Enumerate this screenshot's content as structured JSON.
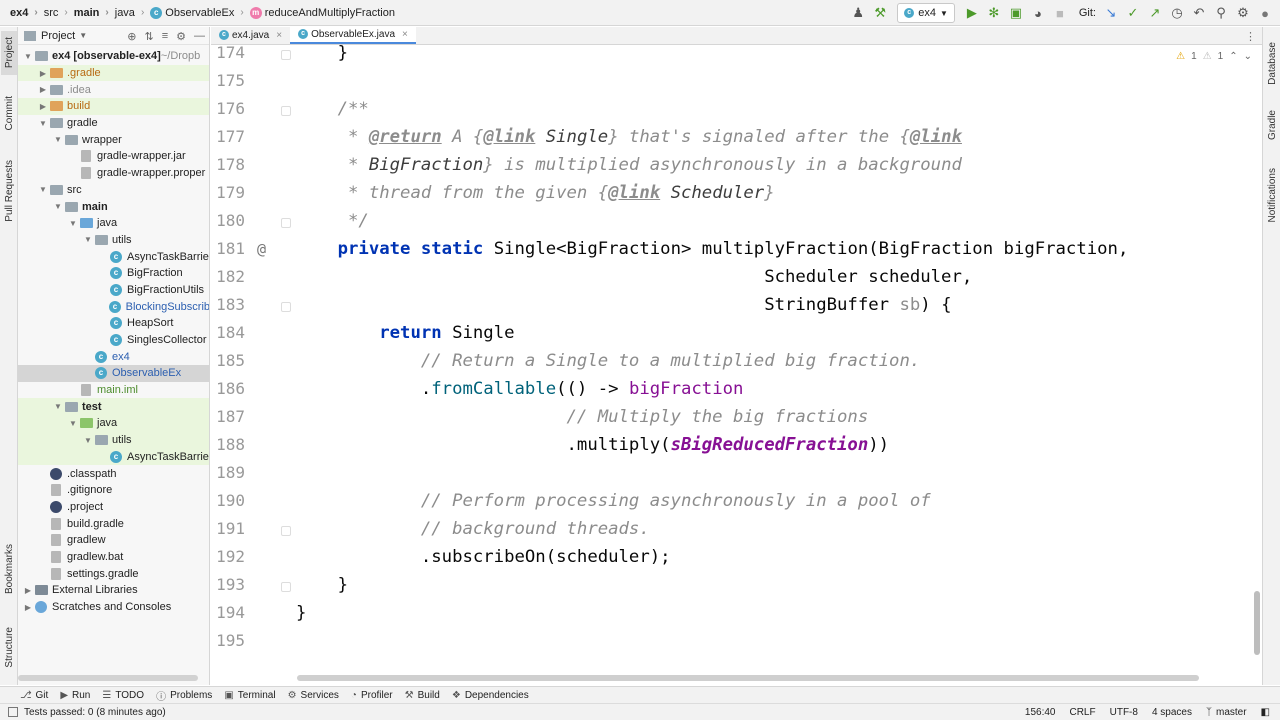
{
  "breadcrumbs": [
    {
      "label": "ex4",
      "bold": true
    },
    {
      "label": "src",
      "bold": false
    },
    {
      "label": "main",
      "bold": true
    },
    {
      "label": "java",
      "bold": false
    },
    {
      "label": "ObservableEx",
      "bold": false
    },
    {
      "label": "reduceAndMultiplyFraction",
      "bold": false
    }
  ],
  "toolbar": {
    "run_config": "ex4",
    "git_label": "Git:"
  },
  "left_tabs": [
    "Project",
    "Commit",
    "Pull Requests",
    "Bookmarks",
    "Structure"
  ],
  "right_tabs": [
    "Database",
    "Gradle",
    "Notifications"
  ],
  "project_panel": {
    "title": "Project",
    "tree": [
      {
        "label": "ex4 [observable-ex4]",
        "suffix": " ~/Dropb",
        "indent": 0,
        "arrow": "open",
        "icon": "folder",
        "bold": true
      },
      {
        "label": ".gradle",
        "indent": 1,
        "arrow": "closed",
        "icon": "folder-orange",
        "style": "orange",
        "row": "green"
      },
      {
        "label": ".idea",
        "indent": 1,
        "arrow": "closed",
        "icon": "folder",
        "style": "muted"
      },
      {
        "label": "build",
        "indent": 1,
        "arrow": "closed",
        "icon": "folder-orange",
        "style": "orange",
        "row": "green"
      },
      {
        "label": "gradle",
        "indent": 1,
        "arrow": "open",
        "icon": "folder"
      },
      {
        "label": "wrapper",
        "indent": 2,
        "arrow": "open",
        "icon": "folder"
      },
      {
        "label": "gradle-wrapper.jar",
        "indent": 3,
        "arrow": "",
        "icon": "file"
      },
      {
        "label": "gradle-wrapper.proper",
        "indent": 3,
        "arrow": "",
        "icon": "file"
      },
      {
        "label": "src",
        "indent": 1,
        "arrow": "open",
        "icon": "folder"
      },
      {
        "label": "main",
        "indent": 2,
        "arrow": "open",
        "icon": "folder",
        "bold": true
      },
      {
        "label": "java",
        "indent": 3,
        "arrow": "open",
        "icon": "folder-blue"
      },
      {
        "label": "utils",
        "indent": 4,
        "arrow": "open",
        "icon": "folder"
      },
      {
        "label": "AsyncTaskBarrie",
        "indent": 5,
        "arrow": "",
        "icon": "class"
      },
      {
        "label": "BigFraction",
        "indent": 5,
        "arrow": "",
        "icon": "class"
      },
      {
        "label": "BigFractionUtils",
        "indent": 5,
        "arrow": "",
        "icon": "class"
      },
      {
        "label": "BlockingSubscrib",
        "indent": 5,
        "arrow": "",
        "icon": "class",
        "style": "blue"
      },
      {
        "label": "HeapSort",
        "indent": 5,
        "arrow": "",
        "icon": "class"
      },
      {
        "label": "SinglesCollector",
        "indent": 5,
        "arrow": "",
        "icon": "class"
      },
      {
        "label": "ex4",
        "indent": 4,
        "arrow": "",
        "icon": "class",
        "style": "blue"
      },
      {
        "label": "ObservableEx",
        "indent": 4,
        "arrow": "",
        "icon": "class",
        "style": "blue",
        "row": "sel"
      },
      {
        "label": "main.iml",
        "indent": 3,
        "arrow": "",
        "icon": "file",
        "style": "green"
      },
      {
        "label": "test",
        "indent": 2,
        "arrow": "open",
        "icon": "folder",
        "bold": true,
        "row": "green"
      },
      {
        "label": "java",
        "indent": 3,
        "arrow": "open",
        "icon": "folder-green",
        "row": "green"
      },
      {
        "label": "utils",
        "indent": 4,
        "arrow": "open",
        "icon": "folder",
        "row": "green"
      },
      {
        "label": "AsyncTaskBarrie",
        "indent": 5,
        "arrow": "",
        "icon": "class",
        "row": "green"
      },
      {
        "label": ".classpath",
        "indent": 1,
        "arrow": "",
        "icon": "dark"
      },
      {
        "label": ".gitignore",
        "indent": 1,
        "arrow": "",
        "icon": "file"
      },
      {
        "label": ".project",
        "indent": 1,
        "arrow": "",
        "icon": "dark"
      },
      {
        "label": "build.gradle",
        "indent": 1,
        "arrow": "",
        "icon": "file"
      },
      {
        "label": "gradlew",
        "indent": 1,
        "arrow": "",
        "icon": "file"
      },
      {
        "label": "gradlew.bat",
        "indent": 1,
        "arrow": "",
        "icon": "file"
      },
      {
        "label": "settings.gradle",
        "indent": 1,
        "arrow": "",
        "icon": "file"
      },
      {
        "label": "External Libraries",
        "indent": 0,
        "arrow": "closed",
        "icon": "lib"
      },
      {
        "label": "Scratches and Consoles",
        "indent": 0,
        "arrow": "closed",
        "icon": "scratch"
      }
    ]
  },
  "tabs": [
    {
      "label": "ex4.java",
      "active": false
    },
    {
      "label": "ObservableEx.java",
      "active": true
    }
  ],
  "inspections": {
    "warnings": "1",
    "weak_warnings": "1"
  },
  "code_lines": [
    {
      "num": "174",
      "tokens": [
        [
          "    }",
          ""
        ]
      ]
    },
    {
      "num": "175",
      "tokens": []
    },
    {
      "num": "176",
      "tokens": [
        [
          "    /**",
          "cm"
        ]
      ]
    },
    {
      "num": "177",
      "tokens": [
        [
          "     * ",
          "cm"
        ],
        [
          "@return",
          "dtag"
        ],
        [
          " A {",
          "cm"
        ],
        [
          "@link",
          "dtag"
        ],
        [
          " Single",
          "dref"
        ],
        [
          "} that's signaled after the {",
          "cm"
        ],
        [
          "@link",
          "dtag"
        ]
      ]
    },
    {
      "num": "178",
      "tokens": [
        [
          "     * ",
          "cm"
        ],
        [
          "BigFraction",
          "dref"
        ],
        [
          "} is multiplied asynchronously in a background",
          "cm"
        ]
      ]
    },
    {
      "num": "179",
      "tokens": [
        [
          "     * thread from the given {",
          "cm"
        ],
        [
          "@link",
          "dtag"
        ],
        [
          " Scheduler",
          "dref"
        ],
        [
          "}",
          "cm"
        ]
      ]
    },
    {
      "num": "180",
      "tokens": [
        [
          "     */",
          "cm"
        ]
      ]
    },
    {
      "num": "181",
      "tokens": [
        [
          "    ",
          ""
        ],
        [
          "private static",
          "kw"
        ],
        [
          " Single<BigFraction> multiplyFraction(BigFraction bigFraction,",
          ""
        ]
      ]
    },
    {
      "num": "182",
      "tokens": [
        [
          "                                             Scheduler scheduler,",
          ""
        ]
      ]
    },
    {
      "num": "183",
      "tokens": [
        [
          "                                             StringBuffer ",
          ""
        ],
        [
          "sb",
          "param"
        ],
        [
          ") {",
          ""
        ]
      ]
    },
    {
      "num": "184",
      "tokens": [
        [
          "        ",
          ""
        ],
        [
          "return",
          "kw"
        ],
        [
          " Single",
          ""
        ]
      ]
    },
    {
      "num": "185",
      "tokens": [
        [
          "            // Return a Single to a multiplied big fraction.",
          "cm"
        ]
      ]
    },
    {
      "num": "186",
      "tokens": [
        [
          "            .",
          ""
        ],
        [
          "fromCallable",
          "mth"
        ],
        [
          "(() -> ",
          ""
        ],
        [
          "bigFraction",
          "fld2"
        ]
      ]
    },
    {
      "num": "187",
      "tokens": [
        [
          "                          // Multiply the big fractions",
          "cm"
        ]
      ]
    },
    {
      "num": "188",
      "tokens": [
        [
          "                          .multiply(",
          ""
        ],
        [
          "sBigReducedFraction",
          "fld"
        ],
        [
          "))",
          ""
        ]
      ]
    },
    {
      "num": "189",
      "tokens": []
    },
    {
      "num": "190",
      "tokens": [
        [
          "            // Perform processing asynchronously in a pool of",
          "cm"
        ]
      ]
    },
    {
      "num": "191",
      "tokens": [
        [
          "            // background threads.",
          "cm"
        ]
      ]
    },
    {
      "num": "192",
      "tokens": [
        [
          "            .subscribeOn(scheduler);",
          ""
        ]
      ]
    },
    {
      "num": "193",
      "tokens": [
        [
          "    }",
          ""
        ]
      ]
    },
    {
      "num": "194",
      "tokens": [
        [
          "}",
          ""
        ]
      ]
    },
    {
      "num": "195",
      "tokens": []
    }
  ],
  "gutter_at_line": "181",
  "bottom_tools": [
    "Git",
    "Run",
    "TODO",
    "Problems",
    "Terminal",
    "Services",
    "Profiler",
    "Build",
    "Dependencies"
  ],
  "status": {
    "message": "Tests passed: 0 (8 minutes ago)",
    "position": "156:40",
    "line_sep": "CRLF",
    "encoding": "UTF-8",
    "indent": "4 spaces",
    "branch": "master"
  }
}
